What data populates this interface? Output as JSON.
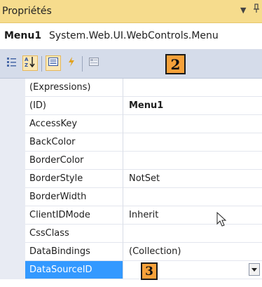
{
  "panel": {
    "title": "Propriétés",
    "title_dropdown_glyph": "▼",
    "title_pin_glyph": "⊥"
  },
  "object": {
    "name": "Menu1",
    "type": "System.Web.UI.WebControls.Menu"
  },
  "toolbar": {
    "buttons": [
      "categorized-icon",
      "alphabetical-icon",
      "properties-icon",
      "events-icon",
      "property-pages-icon"
    ],
    "active_button": "alphabetical-icon"
  },
  "callouts": {
    "toolbar": "2",
    "row": "3"
  },
  "properties": [
    {
      "name": "(Expressions)",
      "value": ""
    },
    {
      "name": "(ID)",
      "value": "Menu1",
      "bold": true
    },
    {
      "name": "AccessKey",
      "value": ""
    },
    {
      "name": "BackColor",
      "value": ""
    },
    {
      "name": "BorderColor",
      "value": ""
    },
    {
      "name": "BorderStyle",
      "value": "NotSet"
    },
    {
      "name": "BorderWidth",
      "value": ""
    },
    {
      "name": "ClientIDMode",
      "value": "Inherit"
    },
    {
      "name": "CssClass",
      "value": ""
    },
    {
      "name": "DataBindings",
      "value": "(Collection)"
    },
    {
      "name": "DataSourceID",
      "value": "",
      "selected": true
    }
  ],
  "colors": {
    "title_bar": "#f6dc8d",
    "toolbar": "#d5dcea",
    "selection": "#3399ff",
    "callout": "#f6a13a"
  }
}
